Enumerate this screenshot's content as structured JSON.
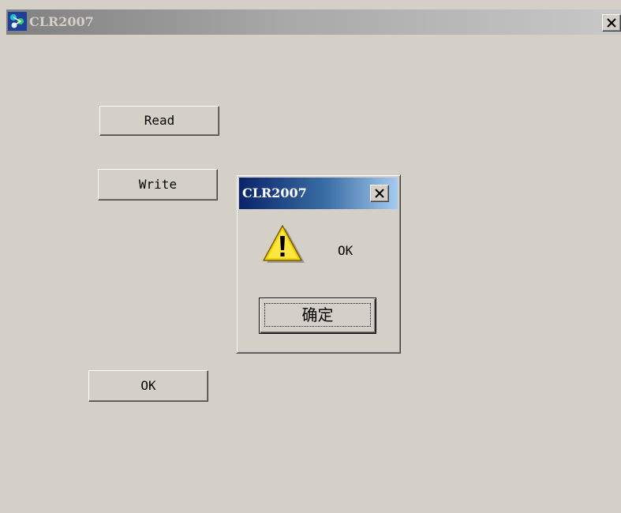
{
  "main_window": {
    "title": "CLR2007",
    "close_icon": "close-icon",
    "app_icon": "app-logo-icon",
    "buttons": {
      "read": "Read",
      "write": "Write",
      "ok": "OK"
    }
  },
  "dialog": {
    "title": "CLR2007",
    "message": "OK",
    "icon": "warning-icon",
    "confirm_label": "确定"
  }
}
